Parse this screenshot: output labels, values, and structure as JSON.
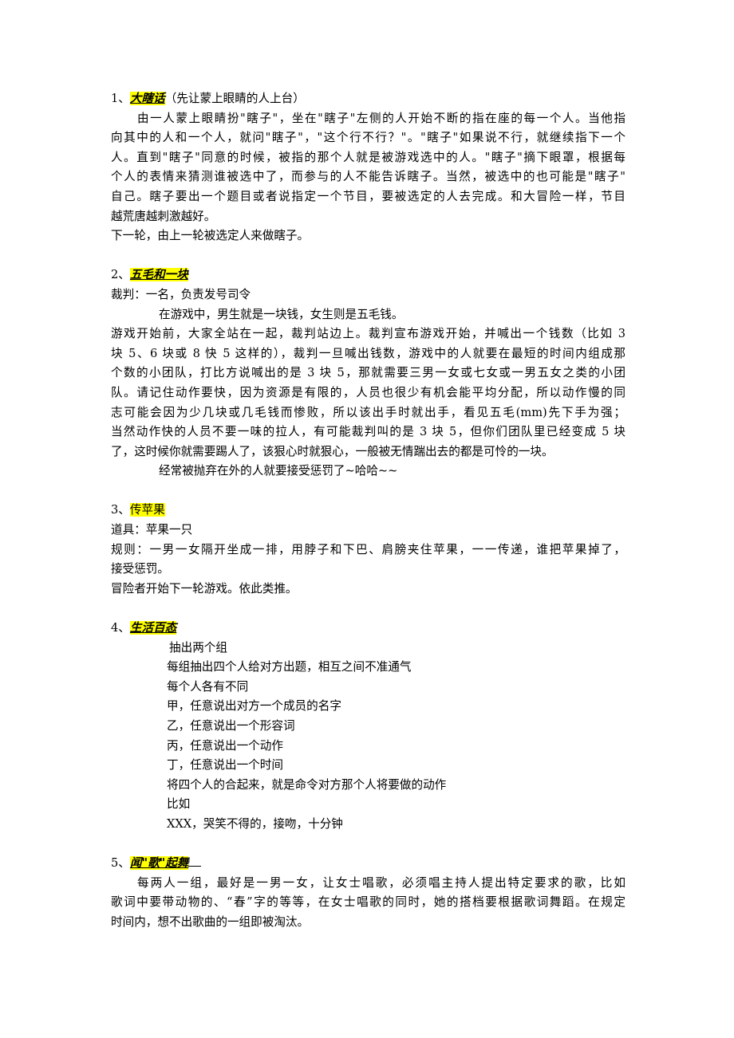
{
  "sections": [
    {
      "number": "1、",
      "title": "大瞎话",
      "title_note": "（先让蒙上眼睛的人上台）",
      "lines": [
        "由一人蒙上眼睛扮\"瞎子\"，坐在\"瞎子\"左侧的人开始不断的指在座的每一个人。当他指",
        "向其中的人和一个人，就问\"瞎子\"，\"这个行不行？\"。\"瞎子\"如果说不行，就继续指下一个",
        "人。直到\"瞎子\"同意的时候，被指的那个人就是被游戏选中的人。\"瞎子\"摘下眼罩，根据每",
        "个人的表情来猜测谁被选中了，而参与的人不能告诉瞎子。当然，被选中的也可能是\"瞎子\"",
        "自己。瞎子要出一个题目或者说指定一个节目，要被选定的人去完成。和大冒险一样，节目",
        "越荒唐越刺激越好。",
        "下一轮，由上一轮被选定人来做瞎子。"
      ]
    },
    {
      "number": "2、",
      "title": "五毛和一块",
      "lines": [
        "裁判：一名，负责发号司令",
        "在游戏中，男生就是一块钱，女生则是五毛钱。",
        "游戏开始前，大家全站在一起，裁判站边上。裁判宣布游戏开始，并喊出一个钱数（比如 3",
        "块 5、6 块或 8 快 5 这样的），裁判一旦喊出钱数，游戏中的人就要在最短的时间内组成那",
        "个数的小团队，打比方说喊出的是 3 块 5，那就需要三男一女或七女或一男五女之类的小团",
        "队。请记住动作要快，因为资源是有限的，人员也很少有机会能平均分配，所以动作慢的同",
        "志可能会因为少几块或几毛钱而惨败，所以该出手时就出手，看见五毛(mm)先下手为强；",
        "当然动作快的人员不要一味的拉人，有可能裁判叫的是 3 块 5，但你们团队里已经变成 5 块",
        "了，这时候你就需要踢人了，该狠心时就狠心，一般被无情踹出去的都是可怜的一块。",
        "经常被抛弃在外的人就要接受惩罚了~哈哈~~"
      ]
    },
    {
      "number": "3、",
      "title": "传苹果",
      "lines": [
        "道具：苹果一只",
        "规则：一男一女隔开坐成一排，用脖子和下巴、肩膀夹住苹果，一一传递，谁把苹果掉了，",
        "接受惩罚。",
        "冒险者开始下一轮游戏。依此类推。"
      ]
    },
    {
      "number": "4、",
      "title": "生活百态",
      "lines": [
        "抽出两个组",
        "每组抽出四个人给对方出题，相互之间不准通气",
        "每个人各有不同",
        "甲，任意说出对方一个成员的名字",
        "乙，任意说出一个形容词",
        "丙，任意说出一个动作",
        "丁，任意说出一个时间",
        "将四个人的合起来，就是命令对方那个人将要做的动作",
        "比如",
        "XXX，哭笑不得的，接吻，十分钟"
      ]
    },
    {
      "number": "5、",
      "title": "闻\"歌\"起舞",
      "lines": [
        "每两人一组，最好是一男一女，让女士唱歌，必须唱主持人提出特定要求的歌，比如",
        "歌词中要带动物的、“春”字的等等，在女士唱歌的同时，她的搭档要根据歌词舞蹈。在规定",
        "时间内，想不出歌曲的一组即被淘汰。"
      ]
    }
  ],
  "colors": {
    "highlight": "#ffff00",
    "text": "#000000"
  }
}
